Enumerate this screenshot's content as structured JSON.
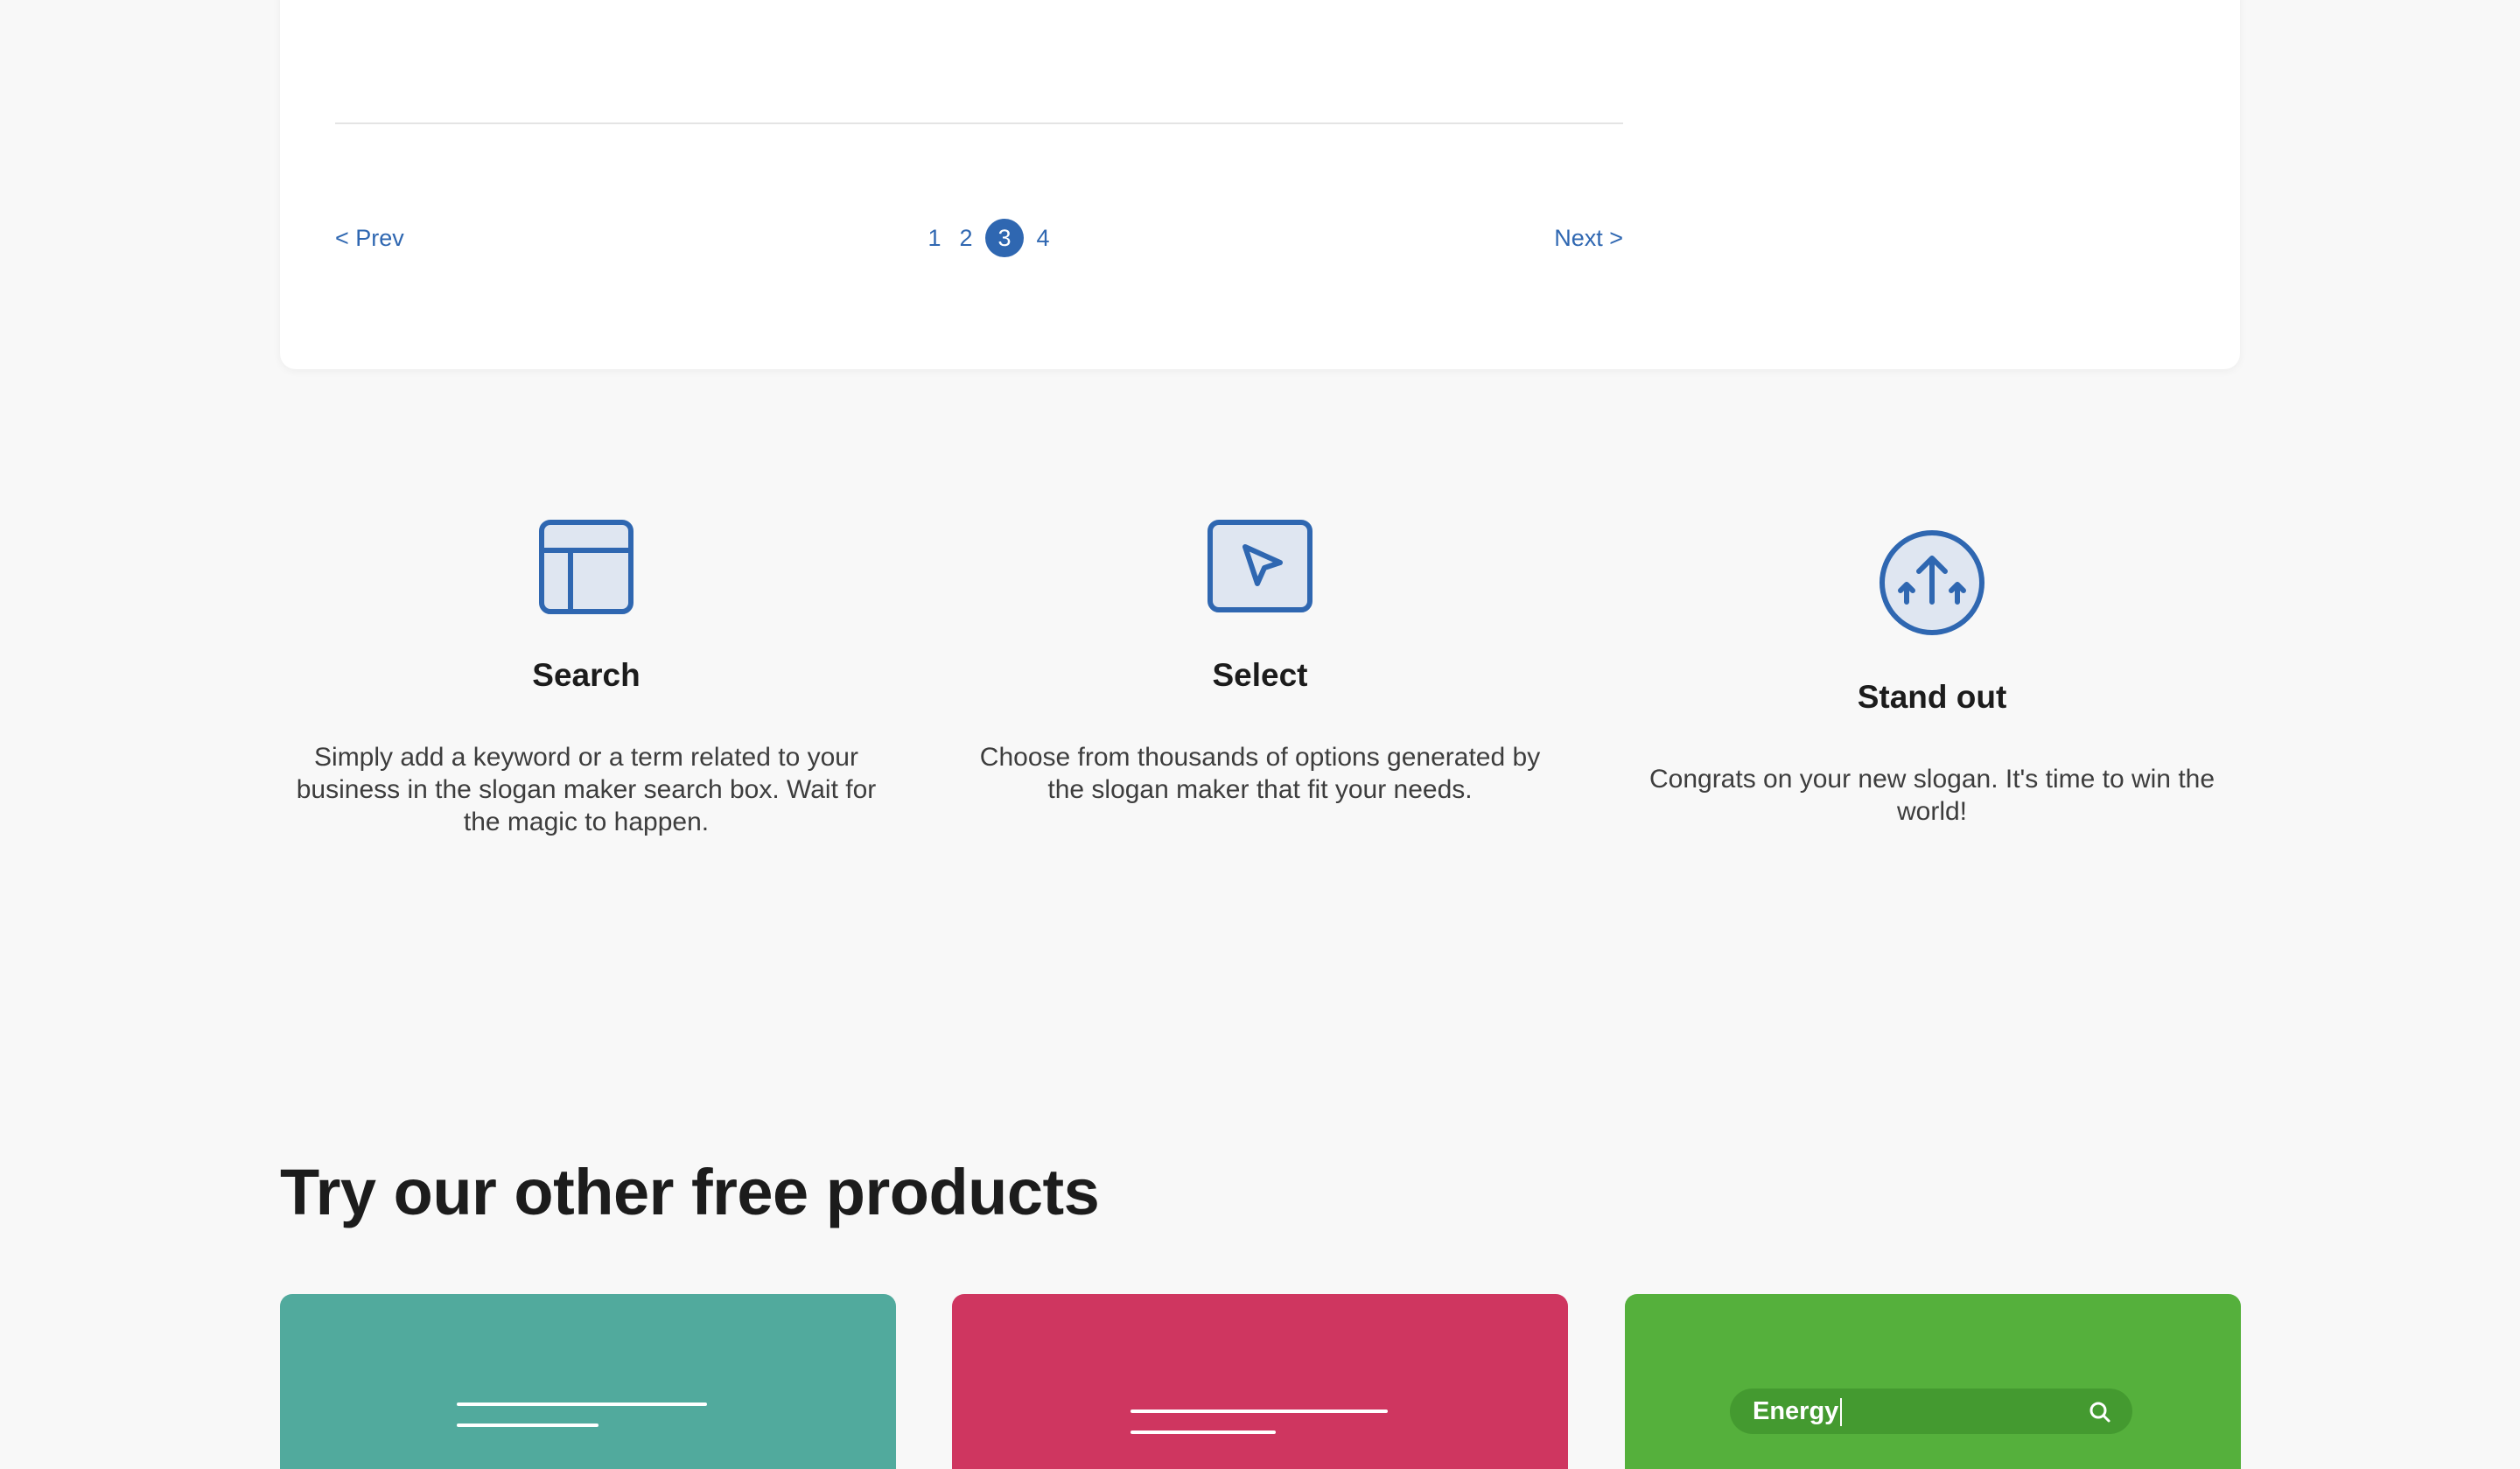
{
  "pagination": {
    "prev_label": "< Prev",
    "next_label": "Next >",
    "pages": [
      "1",
      "2",
      "3",
      "4"
    ],
    "current_page": "3"
  },
  "features": [
    {
      "icon": "layout-icon",
      "title": "Search",
      "description": "Simply add a keyword or a term related to your business in the slogan maker search box. Wait for the magic to happen."
    },
    {
      "icon": "cursor-pointer-icon",
      "title": "Select",
      "description": "Choose from thousands of options generated by the slogan maker that fit your needs."
    },
    {
      "icon": "arrows-up-circle-icon",
      "title": "Stand out",
      "description": "Congrats on your new slogan. It's time to win the world!"
    }
  ],
  "products": {
    "heading": "Try our other free products",
    "cards": [
      {
        "color": "#51aa9d"
      },
      {
        "color": "#cf3660"
      },
      {
        "color": "#55b03c",
        "search_text": "Energy",
        "icon": "search-icon"
      }
    ]
  },
  "colors": {
    "accent": "#2f67b1",
    "icon_fill": "#dfe6f1",
    "page_background": "#f8f8f8",
    "card_background": "#ffffff"
  }
}
